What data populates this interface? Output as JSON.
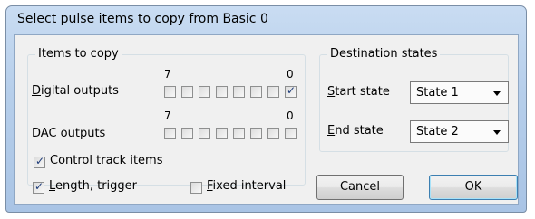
{
  "window": {
    "title": "Select pulse items to copy from Basic 0"
  },
  "items_group": {
    "title": "Items to copy",
    "digital_outputs": {
      "label_accel": "D",
      "label_rest": "igital outputs",
      "high_bit": "7",
      "low_bit": "0",
      "bits": [
        false,
        false,
        false,
        false,
        false,
        false,
        false,
        true
      ]
    },
    "dac_outputs": {
      "label_pre": "D",
      "label_accel": "A",
      "label_rest": "C outputs",
      "high_bit": "7",
      "low_bit": "0",
      "bits": [
        false,
        false,
        false,
        false,
        false,
        false,
        false,
        false
      ]
    },
    "control_track": {
      "label": "Control track items",
      "checked": true
    },
    "length_trigger": {
      "label_accel": "L",
      "label_rest": "ength, trigger",
      "checked": true
    },
    "fixed_interval": {
      "label_accel": "F",
      "label_rest": "ixed interval",
      "checked": false
    }
  },
  "dest_group": {
    "title": "Destination states",
    "start_state": {
      "label_accel": "S",
      "label_rest": "tart state",
      "value": "State 1"
    },
    "end_state": {
      "label_accel": "E",
      "label_rest": "nd state",
      "value": "State 2"
    }
  },
  "buttons": {
    "cancel": "Cancel",
    "ok": "OK"
  }
}
